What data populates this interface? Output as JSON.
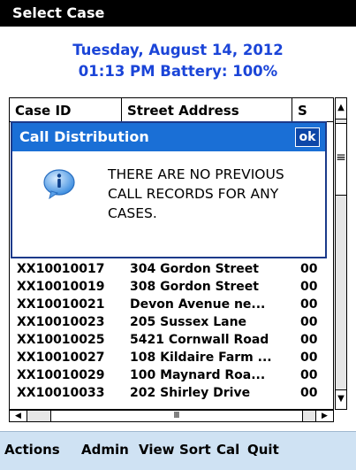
{
  "window": {
    "title": "Select Case"
  },
  "status": {
    "date": "Tuesday, August 14, 2012",
    "time_battery": "01:13 PM  Battery: 100%"
  },
  "table": {
    "headers": [
      "Case ID",
      "Street Address",
      "S"
    ],
    "hidden_prefix_rows": [
      "XX",
      "XX",
      "XX",
      "XX",
      "XX",
      "XX",
      "XX",
      "XX"
    ],
    "rows": [
      {
        "case_id": "XX10010017",
        "address": "304 Gordon Street",
        "s": "00"
      },
      {
        "case_id": "XX10010019",
        "address": "308 Gordon Street",
        "s": "00"
      },
      {
        "case_id": "XX10010021",
        "address": "Devon Avenue  ne...",
        "s": "00"
      },
      {
        "case_id": "XX10010023",
        "address": "205 Sussex Lane",
        "s": "00"
      },
      {
        "case_id": "XX10010025",
        "address": "5421 Cornwall Road",
        "s": "00"
      },
      {
        "case_id": "XX10010027",
        "address": "108 Kildaire Farm ...",
        "s": "00"
      },
      {
        "case_id": "XX10010029",
        "address": "100 Maynard Roa...",
        "s": "00"
      },
      {
        "case_id": "XX10010033",
        "address": "202 Shirley Drive",
        "s": "00"
      }
    ]
  },
  "dialog": {
    "title": "Call Distribution",
    "ok_label": "ok",
    "message": "THERE ARE NO PREVIOUS CALL RECORDS FOR ANY CASES.",
    "icon": "info-icon"
  },
  "menu": {
    "items": [
      "Actions",
      "Admin",
      "View",
      "Sort",
      "Cal",
      "Quit"
    ]
  },
  "colors": {
    "accent": "#1b45d8",
    "dialog_title": "#1a6fd6",
    "menubar": "#cfe2f3"
  }
}
